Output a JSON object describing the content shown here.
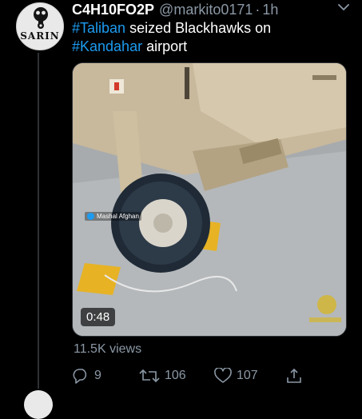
{
  "user": {
    "display_name": "C4H10FO2P",
    "handle": "@markito0171",
    "separator": "·",
    "time": "1h",
    "avatar_text": "SARIN"
  },
  "tweet": {
    "hashtag1": "#Taliban",
    "text1": " seized Blackhawks on",
    "hashtag2": "#Kandahar",
    "text2": " airport"
  },
  "media": {
    "watermark_label": "Mashal Afghan",
    "duration": "0:48"
  },
  "stats": {
    "views": "11.5K views",
    "replies": "9",
    "retweets": "106",
    "likes": "107"
  },
  "icons": {
    "more": "chevron-down-icon",
    "reply": "reply-icon",
    "retweet": "retweet-icon",
    "like": "heart-icon",
    "share": "share-icon"
  },
  "colors": {
    "background": "#000000",
    "hashtag": "#1d9bf0",
    "muted": "#8b98a5"
  }
}
